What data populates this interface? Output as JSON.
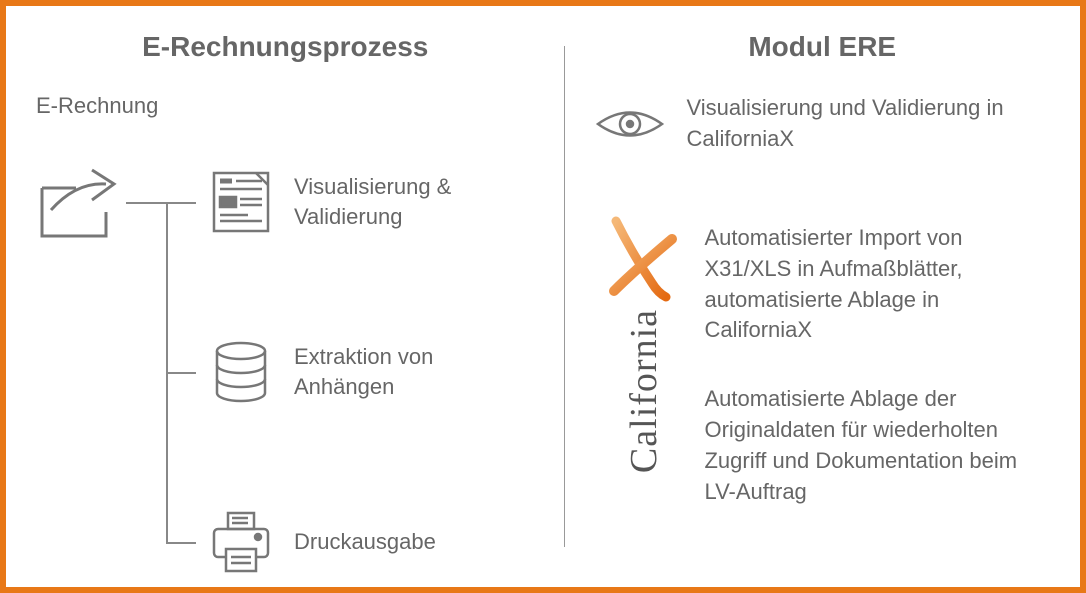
{
  "left": {
    "heading": "E-Rechnungsprozess",
    "source_label": "E-Rechnung",
    "nodes": [
      {
        "text": "Visualisierung & Validierung"
      },
      {
        "text": "Extraktion von Anhängen"
      },
      {
        "text": "Druckausgabe"
      }
    ]
  },
  "right": {
    "heading": "Modul ERE",
    "eye_text": "Visualisierung und Validierung in CaliforniaX",
    "logo_word": "California",
    "paras": [
      "Automatisierter Import von X31/XLS in Aufmaßblätter, automatisierte Ablage in CaliforniaX",
      "Automatisierte Ablage der Originaldaten für wiederholten Zugriff und Dokumentation beim LV-Auftrag"
    ]
  },
  "colors": {
    "border": "#e87817",
    "text": "#666",
    "stroke": "#777"
  }
}
